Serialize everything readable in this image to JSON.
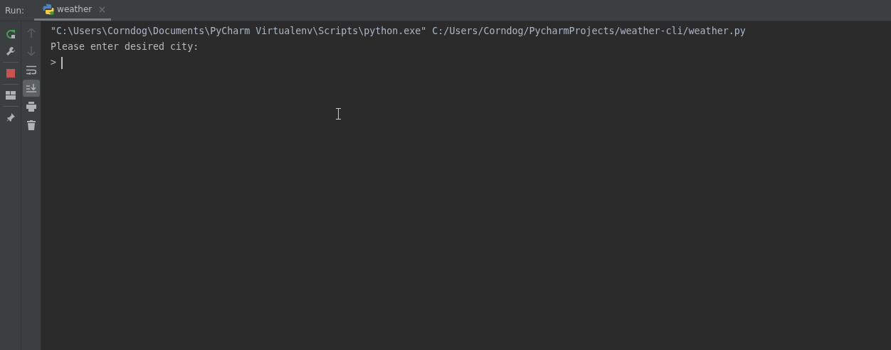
{
  "run_label": "Run:",
  "tabs": [
    {
      "label": "weather",
      "selected": true
    }
  ],
  "left_toolbar": [
    [
      {
        "kind": "rerun"
      },
      {
        "kind": "wrench"
      }
    ],
    [
      {
        "kind": "stop"
      }
    ],
    [
      {
        "kind": "layout"
      }
    ],
    [
      {
        "kind": "pin"
      }
    ]
  ],
  "side_toolbar": [
    {
      "kind": "up",
      "disabled": true,
      "on": false
    },
    {
      "kind": "down",
      "disabled": true,
      "on": false
    },
    {
      "kind": "wrap",
      "disabled": false,
      "on": false
    },
    {
      "kind": "scroll-end",
      "disabled": false,
      "on": true
    },
    {
      "kind": "print",
      "disabled": false,
      "on": false
    },
    {
      "kind": "trash",
      "disabled": false,
      "on": false
    }
  ],
  "console": {
    "lines": [
      {
        "kind": "command",
        "text": "\"C:\\Users\\Corndog\\Documents\\PyCharm Virtualenv\\Scripts\\python.exe\" C:/Users/Corndog/PycharmProjects/weather-cli/weather.py"
      },
      {
        "kind": "output",
        "text": "Please enter desired city:"
      }
    ],
    "prompt": ">"
  }
}
